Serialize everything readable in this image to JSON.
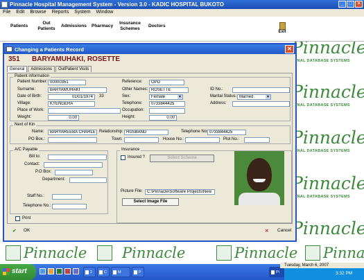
{
  "app": {
    "title": "Pinnacle Hospital Management System - Version 3.0 - KADIC HOSPITAL BUKOTO",
    "window_buttons": [
      "_",
      "□",
      "×"
    ]
  },
  "menu": [
    "File",
    "Edit",
    "Browse",
    "Reports",
    "System",
    "Window"
  ],
  "toolbar": {
    "items": [
      "Patients",
      "Out Patients",
      "Admissions",
      "Pharmacy",
      "Insurance Schemes",
      "Doctors"
    ],
    "exit": "Exit"
  },
  "brand": {
    "word": "Pinnacle",
    "sub": "ONAL DATABASE SYSTEMS",
    "color": "#3a8a3a"
  },
  "dialog": {
    "title": "Changing a Patients Record",
    "patient_id": "351",
    "patient_name": "BARYAMUHAKI, ROSETTE",
    "tabs": [
      "General",
      "Admissions",
      "OutPatient Visits"
    ],
    "patient_info": {
      "legend": "Patient information",
      "patient_number_label": "Patient Number:",
      "patient_number": "00000351",
      "reference_label": "Reference:",
      "reference": "OPD",
      "surname_label": "Surname:",
      "surname": "BARYAMUHAKI",
      "other_names_label": "Other Names:",
      "other_names": "ROSETTE",
      "id_no_label": "ID No.:",
      "id_no": "",
      "dob_label": "Date of Birth:",
      "dob": "01/01/1974",
      "age": "33",
      "sex_label": "Sex:",
      "sex": "Female",
      "marital_label": "Marital Status:",
      "marital": "Married",
      "village_label": "Village:",
      "village": "KYENGERA",
      "telephone_label": "Telephone:",
      "telephone": "0733844425",
      "address_label": "Address:",
      "address": "",
      "place_of_work_label": "Place of Work:",
      "place_of_work": "",
      "occupation_label": "Occupation:",
      "occupation": "",
      "weight_label": "Weight:",
      "weight": "0.00",
      "height_label": "Height:",
      "height": "0.00"
    },
    "next_of_kin": {
      "legend": "Next of Kin",
      "name_label": "Name:",
      "name": "BARYAREEBA CHARLE",
      "relationship_label": "Relationship:",
      "relationship": "HUSBAND",
      "telephone_label": "Telephone No:",
      "telephone": "0733844425",
      "po_box_label": "PO Box.:",
      "po_box": "",
      "town_label": "Town:",
      "town": "",
      "house_label": "House No.:",
      "house": "",
      "plot_label": "Plot No.:",
      "plot": ""
    },
    "ac_payable": {
      "legend": "A/C Payable",
      "bill_to_label": "Bill to:",
      "contact_label": "Contact:",
      "po_box_label": "P.O Box:",
      "department_label": "Department:",
      "staff_no_label": "Staff No.:",
      "telephone_label": "Telephone No.:"
    },
    "insurance": {
      "legend": "Insurance",
      "insured_label": "Insured ?",
      "select_scheme": "Select Scheme",
      "picture_file_label": "Picture File:",
      "picture_file": "C:\\Pinnacle\\Software Projects\\New",
      "select_image": "Select Image File"
    },
    "print_label": "Print",
    "ok_label": "OK",
    "cancel_label": "Cancel"
  },
  "taskbar": {
    "start": "start",
    "tasks": [
      "2",
      "C",
      "M",
      "P",
      "Pi"
    ],
    "date": "Tuesday, March 6, 2007",
    "time": "3:32 PM"
  }
}
